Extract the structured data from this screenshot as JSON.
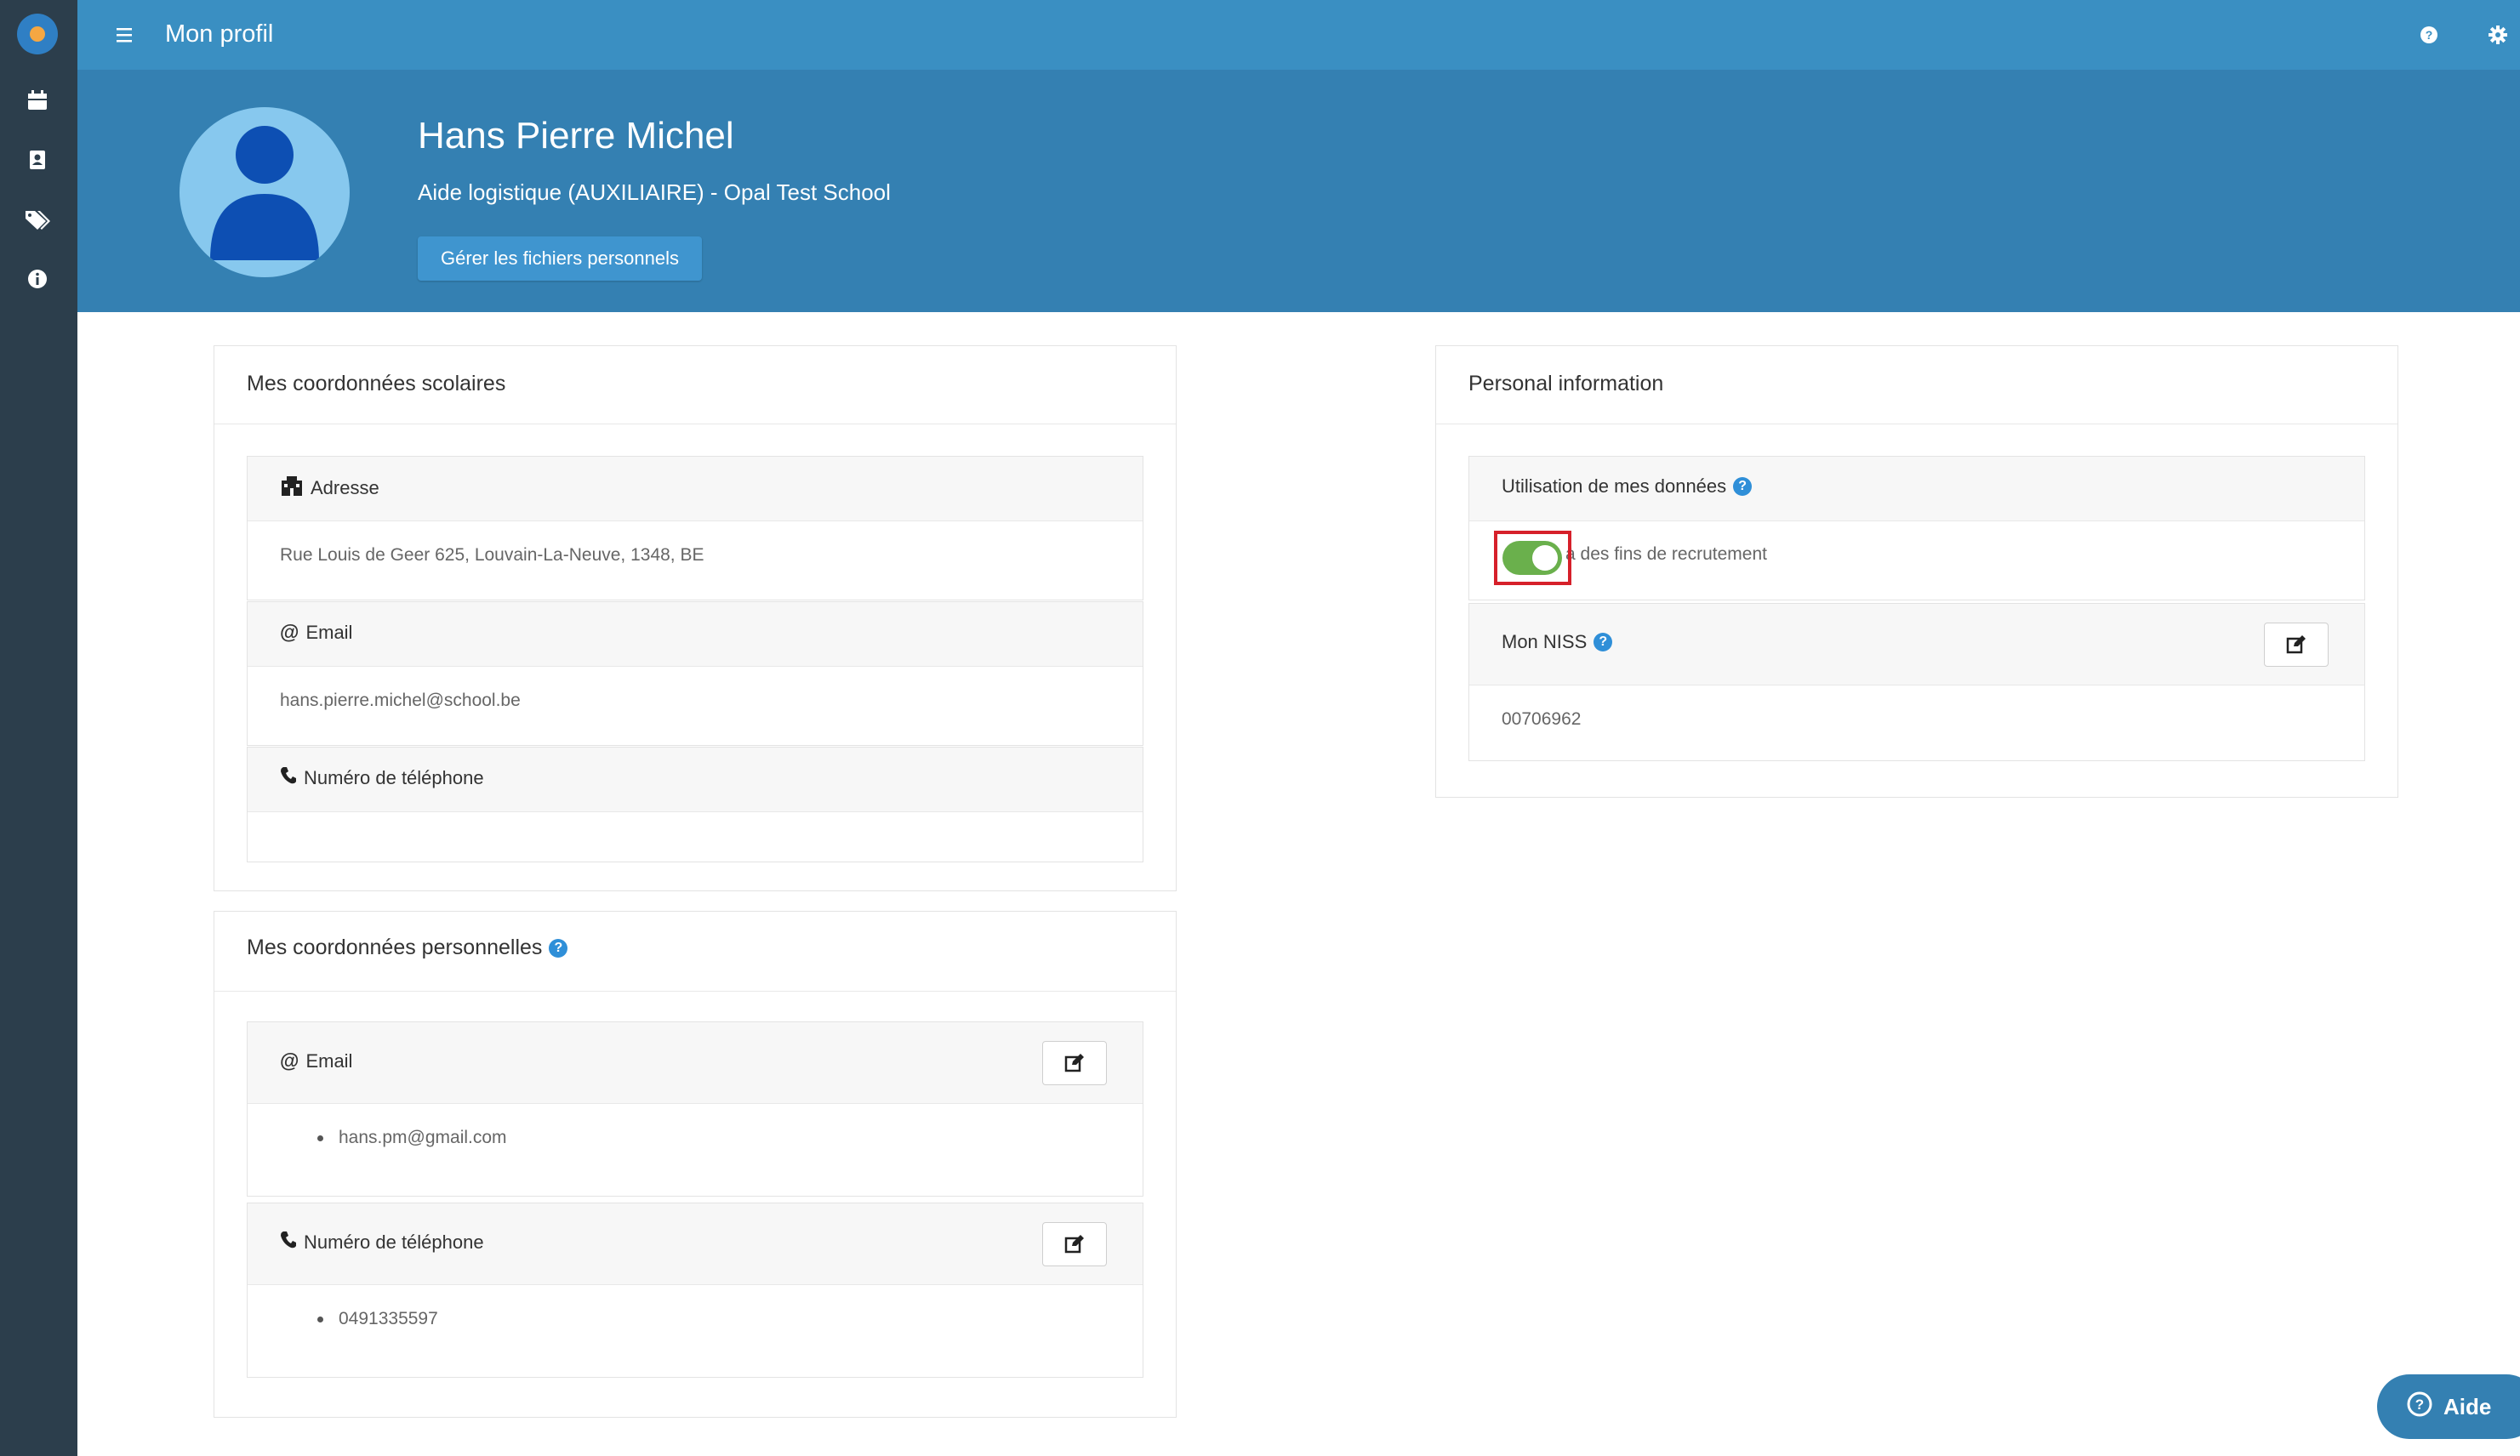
{
  "topbar": {
    "title": "Mon profil"
  },
  "profile": {
    "name": "Hans Pierre Michel",
    "role": "Aide logistique (AUXILIAIRE) - Opal Test School",
    "files_button": "Gérer les fichiers personnels"
  },
  "school_contact": {
    "title": "Mes coordonnées scolaires",
    "address_label": "Adresse",
    "address_value": "Rue Louis de Geer 625, Louvain-La-Neuve, 1348, BE",
    "email_label": "Email",
    "email_value": "hans.pierre.michel@school.be",
    "phone_label": "Numéro de téléphone",
    "phone_value": ""
  },
  "personal_contact": {
    "title": "Mes coordonnées personnelles",
    "email_label": "Email",
    "emails": [
      "hans.pm@gmail.com"
    ],
    "phone_label": "Numéro de téléphone",
    "phones": [
      "0491335597"
    ]
  },
  "personal_info": {
    "title": "Personal information",
    "data_usage_label": "Utilisation de mes données",
    "recruitment_toggle_label": "à des fins de recrutement",
    "recruitment_toggle_on": true,
    "niss_label": "Mon NISS",
    "niss_value": "00706962"
  },
  "help_button": {
    "label": "Aide"
  },
  "colors": {
    "sidebar": "#2c3e4c",
    "topbar": "#3a8fc2",
    "header": "#3480b2",
    "toggle_on": "#6ab04c",
    "highlight": "#d6202a"
  }
}
